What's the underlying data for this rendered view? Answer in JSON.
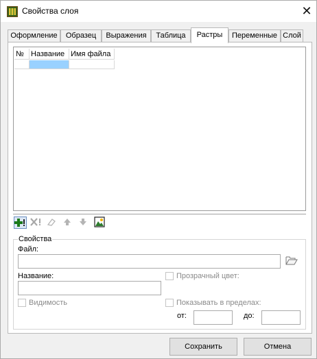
{
  "window": {
    "title": "Свойства слоя",
    "close_symbol": "✕"
  },
  "tabs": [
    {
      "label": "Оформление",
      "active": false
    },
    {
      "label": "Образец",
      "active": false
    },
    {
      "label": "Выражения",
      "active": false
    },
    {
      "label": "Таблица",
      "active": false
    },
    {
      "label": "Растры",
      "active": true
    },
    {
      "label": "Переменные",
      "active": false
    },
    {
      "label": "Слой",
      "active": false
    }
  ],
  "raster_table": {
    "columns": [
      "№",
      "Название",
      "Имя файла"
    ],
    "rows": [
      {
        "number": "",
        "name": "",
        "file": "",
        "name_selected": true
      }
    ]
  },
  "toolbar": {
    "add_icon": "plus-icon",
    "delete_icon": "delete-icon",
    "edit_icon": "eraser-icon",
    "up_icon": "arrow-up-icon",
    "down_icon": "arrow-down-icon",
    "image_icon": "image-icon"
  },
  "properties": {
    "group_title": "Свойства",
    "file_label": "Файл:",
    "file_value": "",
    "name_label": "Название:",
    "name_value": "",
    "transparent_color_label": "Прозрачный цвет:",
    "transparent_color_checked": false,
    "visibility_label": "Видимость",
    "visibility_checked": false,
    "show_within_label": "Показывать в пределах:",
    "show_within_checked": false,
    "from_label": "от:",
    "from_value": "",
    "to_label": "до:",
    "to_value": ""
  },
  "buttons": {
    "save_label": "Сохранить",
    "cancel_label": "Отмена"
  },
  "colors": {
    "selection": "#99d1ff",
    "add_icon": "#1a7a1a",
    "disabled": "#b0b0b0"
  }
}
